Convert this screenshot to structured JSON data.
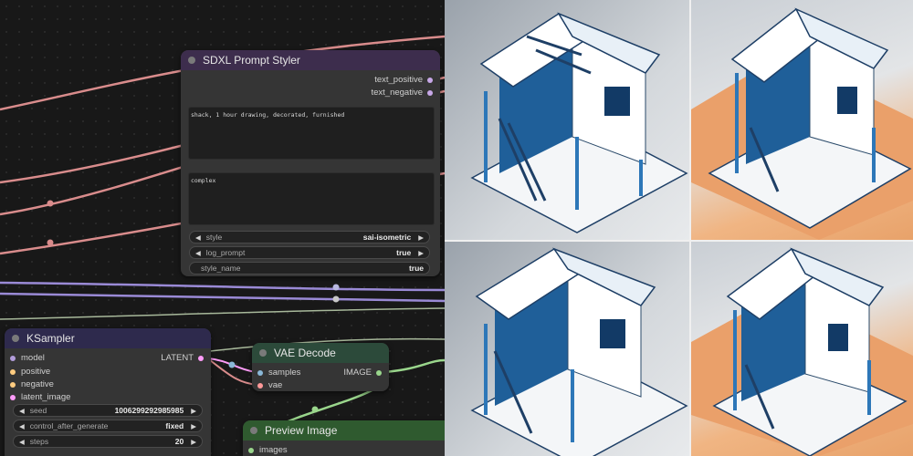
{
  "nodes": {
    "styler": {
      "title": "SDXL Prompt Styler",
      "outputs": [
        "text_positive",
        "text_negative"
      ],
      "text_positive": "shack, 1 hour drawing, decorated, furnished",
      "text_negative": "complex",
      "widgets": [
        {
          "label": "style",
          "value": "sai-isometric"
        },
        {
          "label": "log_prompt",
          "value": "true"
        },
        {
          "label": "style_name",
          "value": "true"
        }
      ]
    },
    "ksampler": {
      "title": "KSampler",
      "inputs": [
        "model",
        "positive",
        "negative",
        "latent_image"
      ],
      "output": "LATENT",
      "widgets": [
        {
          "label": "seed",
          "value": "1006299292985985"
        },
        {
          "label": "control_after_generate",
          "value": "fixed"
        },
        {
          "label": "steps",
          "value": "20"
        }
      ]
    },
    "vae_decode": {
      "title": "VAE Decode",
      "inputs": [
        "samples",
        "vae"
      ],
      "output": "IMAGE"
    },
    "preview": {
      "title": "Preview Image",
      "inputs": [
        "images"
      ]
    }
  },
  "colors": {
    "canvas": "#181818",
    "node_body": "#353535",
    "styler_header": "#3d2d4d",
    "ksampler_header": "#2e2a4d",
    "vae_header": "#2c4a3a",
    "preview_header": "#2f5a2f",
    "wire_pink": "#d98c8c",
    "wire_purple": "#9a8ad6",
    "wire_green": "#9ad68c",
    "wire_teal": "#8ab8a8",
    "socket_latent": "#ff9cf9",
    "socket_image": "#64b5f6"
  },
  "images": {
    "panels": [
      {
        "name": "render-top-left",
        "bg": "gray-gradient"
      },
      {
        "name": "render-top-right",
        "bg": "orange-gray"
      },
      {
        "name": "render-bottom-left",
        "bg": "gray-gradient"
      },
      {
        "name": "render-bottom-right",
        "bg": "orange-gray"
      }
    ]
  }
}
